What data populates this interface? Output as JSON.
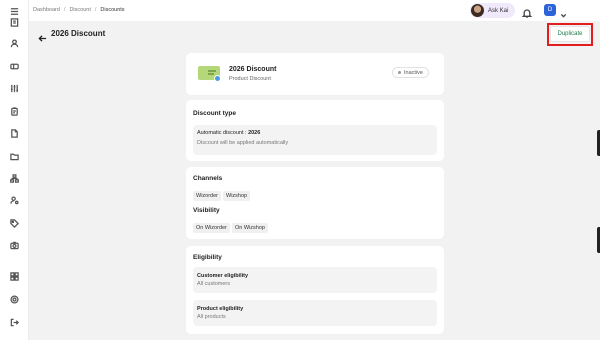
{
  "breadcrumb": [
    "Dashboard",
    "Discount",
    "Discounts"
  ],
  "user": {
    "name": "Ask Kai",
    "initial": "D"
  },
  "page": {
    "title": "2026 Discount",
    "duplicate_label": "Duplicate"
  },
  "summary": {
    "name": "2026 Discount",
    "type": "Product Discount",
    "status": "Inactive"
  },
  "discount_type": {
    "heading": "Discount type",
    "label": "Automatic discount : ",
    "value": "2026",
    "description": "Discount will be applied automatically"
  },
  "channels": {
    "heading": "Channels",
    "items": [
      "Wizorder",
      "Wizshop"
    ]
  },
  "visibility": {
    "heading": "Visibility",
    "items": [
      "On Wizorder",
      "On Wizshop"
    ]
  },
  "eligibility": {
    "heading": "Eligibility",
    "customer_label": "Customer eligibility",
    "customer_value": "All customers",
    "product_label": "Product eligibility",
    "product_value": "All products"
  },
  "sidebar_icons": [
    "menu-icon",
    "book-icon",
    "user-icon",
    "ticket-icon",
    "sliders-icon",
    "clipboard-icon",
    "file-icon",
    "folder-icon",
    "network-icon",
    "user-settings-icon",
    "tag-icon",
    "camera-icon",
    "grid-icon",
    "settings-icon",
    "logout-icon"
  ],
  "colors": {
    "accent_green": "#1f7a4a",
    "highlight_red": "#e01e1e",
    "avatar_blue": "#2c63d8",
    "pill_bg": "#efe9fb"
  }
}
